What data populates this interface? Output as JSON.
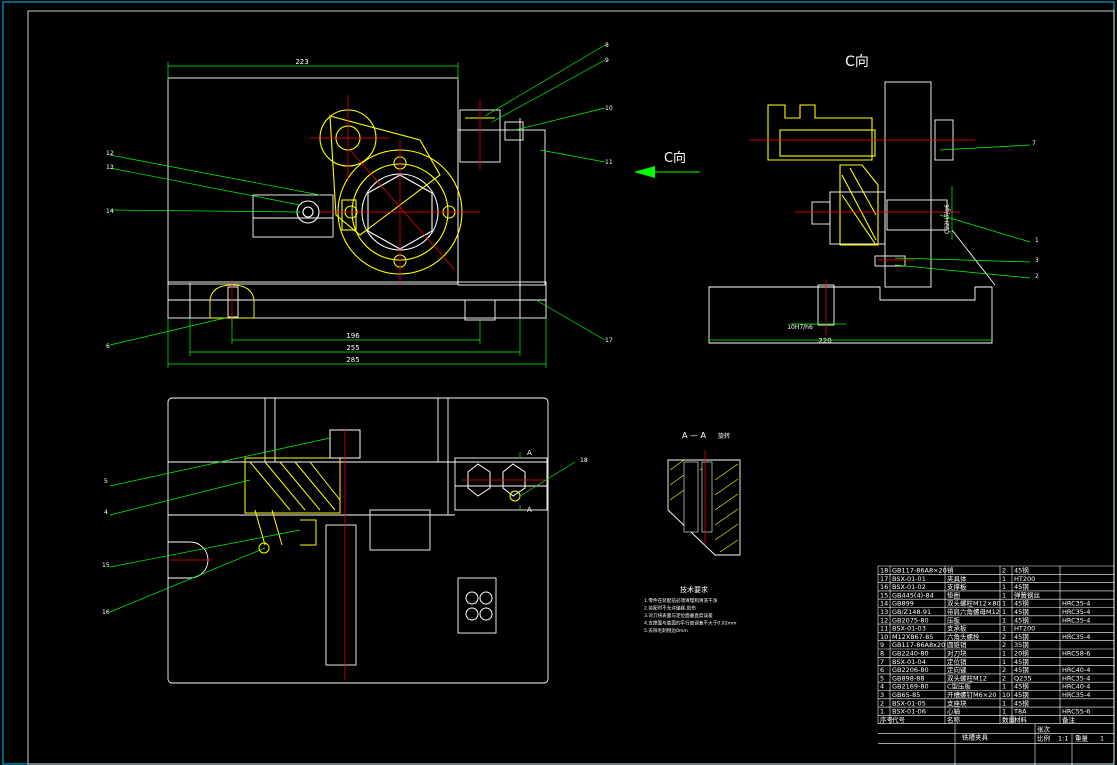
{
  "colors": {
    "background": "#000000",
    "outline": "#ffffff",
    "dimension": "#00ff00",
    "annotation": "#00ff00",
    "part": "#ffff00",
    "centerline": "#ff0000",
    "hatch": "#ffff00",
    "frame": "#00c8ff",
    "table": "#ffffff"
  },
  "views": {
    "c_view_title": "C向",
    "c_arrow_label": "C向",
    "section_title": "A — A",
    "section_sub": "旋转",
    "section_marks": [
      "A",
      "A"
    ]
  },
  "dimensions": {
    "top_width": "223",
    "bottom_d1": "196",
    "bottom_d2": "255",
    "bottom_d3": "285",
    "side_width": "220",
    "side_fit": "10H7/h6",
    "side_vertical": "Ç22H7/g6"
  },
  "callouts": {
    "front": [
      "8",
      "9",
      "10",
      "11",
      "12",
      "13",
      "14",
      "6",
      "17"
    ],
    "side": [
      "7",
      "1",
      "3",
      "2"
    ],
    "plan": [
      "5",
      "4",
      "15",
      "16",
      "18"
    ]
  },
  "notes": {
    "title": "技术要求",
    "lines": [
      "1.零件在装配前必须清理和清洗干净",
      "2.装配时不允许磕碰,划伤",
      "3.对刀块表面与定位面垂直度误差",
      "4.支撑面与底面的平行度误差不大于0.02mm",
      "5.去除毛刺锐边0mm"
    ]
  },
  "bom": {
    "rows": [
      [
        "18",
        "GB117-86A8×20",
        "销",
        "2",
        "45钢",
        ""
      ],
      [
        "17",
        "BSX-01-01",
        "夹具体",
        "1",
        "HT200",
        ""
      ],
      [
        "16",
        "BSX-01-02",
        "支撑板",
        "1",
        "45钢",
        ""
      ],
      [
        "15",
        "GB445(4)-84",
        "垫圈",
        "1",
        "弹簧钢丝",
        ""
      ],
      [
        "14",
        "GB899",
        "双头螺柱M12×80",
        "1",
        "45钢",
        "HRC35-4"
      ],
      [
        "13",
        "GB/Z148-91",
        "带肩六角螺母M12",
        "1",
        "45钢",
        "HRC35-4"
      ],
      [
        "12",
        "GB2075-80",
        "压板",
        "1",
        "45钢",
        "HRC35-4"
      ],
      [
        "11",
        "BSX-01-03",
        "支承板",
        "1",
        "HT200",
        ""
      ],
      [
        "10",
        "M12X867-85",
        "六角头螺栓",
        "2",
        "45钢",
        "HRC35-4"
      ],
      [
        "9",
        "GB117-86A8x20",
        "圆锥销",
        "2",
        "35钢",
        ""
      ],
      [
        "8",
        "GB2240-80",
        "对刀块",
        "1",
        "20钢",
        "HRC58-6"
      ],
      [
        "7",
        "BSX-01-04",
        "定位销",
        "1",
        "45钢",
        ""
      ],
      [
        "6",
        "GB2206-80",
        "定向键",
        "2",
        "45钢",
        "HRC40-4"
      ],
      [
        "5",
        "GB898-88",
        "双头螺柱M12",
        "2",
        "Q235",
        "HRC35-4"
      ],
      [
        "4",
        "GB2169-80",
        "C型压板",
        "1",
        "45钢",
        "HRC40-4"
      ],
      [
        "3",
        "GB65-85",
        "开槽螺钉M6×20",
        "10",
        "45钢",
        "HRC35-4"
      ],
      [
        "2",
        "BSX-01-05",
        "支座块",
        "1",
        "45钢",
        ""
      ],
      [
        "1",
        "BSX-01-06",
        "心轴",
        "1",
        "T8A",
        "HRC55-6"
      ]
    ],
    "header": [
      "序号",
      "代号",
      "名称",
      "数量",
      "材料",
      "备注"
    ],
    "title_block": {
      "title": "铣槽夹具",
      "ratio_label": "比例",
      "sheet_label": "张次",
      "weight_label": "重量",
      "count": "1",
      "ratio": "1:1"
    }
  }
}
